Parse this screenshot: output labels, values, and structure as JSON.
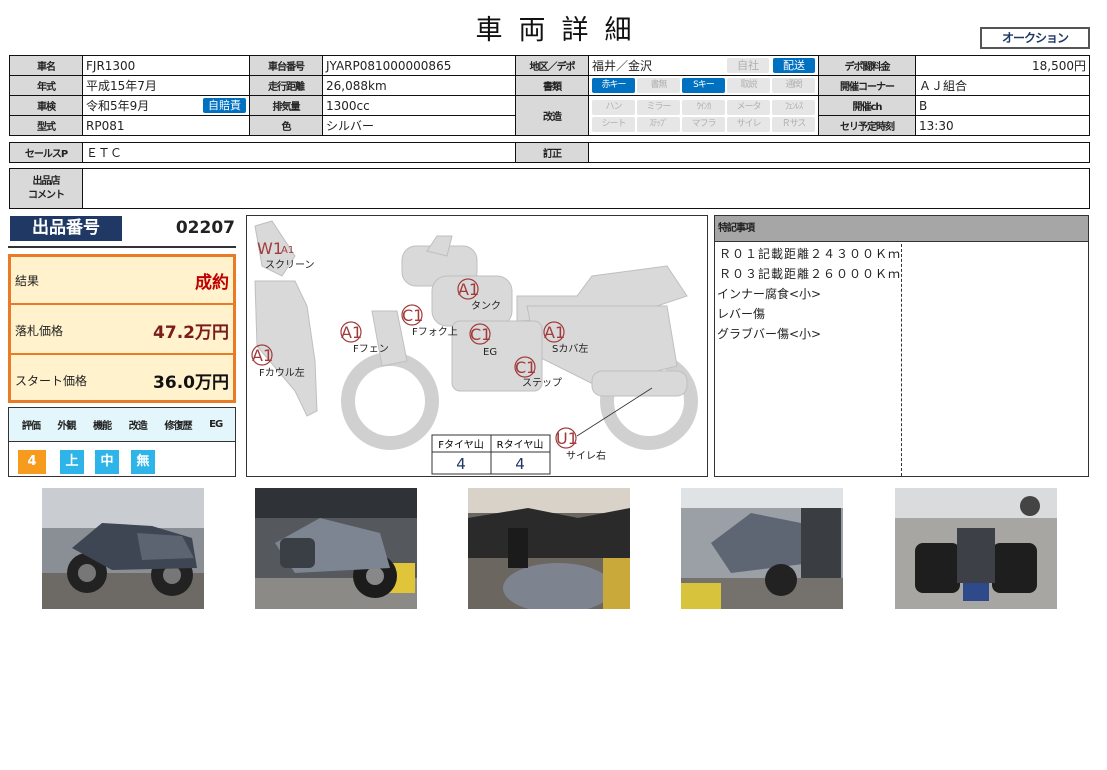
{
  "page": {
    "title": "車両詳細",
    "auction_button": "オークション"
  },
  "spec": {
    "labels": {
      "model": "車名",
      "frame": "車台番号",
      "region": "地区／デポ",
      "depo_fee": "デポ闘料金",
      "year": "年式",
      "mileage": "走行距離",
      "docs": "書類",
      "corner": "開催コーナー",
      "inspection": "車検",
      "displacement": "排気量",
      "modified": "改造",
      "channel": "開催ch",
      "type": "型式",
      "color": "色",
      "time": "セリ予定時刻",
      "sales_point": "セールスP",
      "correction": "訂正",
      "comment": "出品店\nコメント"
    },
    "model": "FJR1300",
    "frame_no": "JYARP081000000865",
    "region": "福井／金沢",
    "depo_fee": "18,500円",
    "year": "平成15年7月",
    "mileage": "26,088km",
    "corner": "ＡＪ組合",
    "inspection": "令和5年9月",
    "insurance_badge": "自賠責",
    "displacement": "1300cc",
    "channel": "B",
    "type": "RP081",
    "color": "シルバー",
    "auction_time": "13:30",
    "sales_point": "ＥＴＣ",
    "correction": "",
    "comment": "",
    "region_badges": [
      {
        "label": "自社",
        "on": false
      },
      {
        "label": "配送",
        "on": true
      }
    ],
    "doc_badges": [
      {
        "label": "赤キー",
        "on": true
      },
      {
        "label": "書無",
        "on": false
      },
      {
        "label": "Sキー",
        "on": true
      },
      {
        "label": "取説",
        "on": false
      },
      {
        "label": "通関",
        "on": false
      }
    ],
    "mod_badges": [
      {
        "label": "ハン",
        "on": false
      },
      {
        "label": "ミラー",
        "on": false
      },
      {
        "label": "ｳｲﾝｶ",
        "on": false
      },
      {
        "label": "メータ",
        "on": false
      },
      {
        "label": "ﾌｪﾝﾚｽ",
        "on": false
      },
      {
        "label": "シート",
        "on": false
      },
      {
        "label": "ｽﾃｯﾌﾟ",
        "on": false
      },
      {
        "label": "マフラ",
        "on": false
      },
      {
        "label": "サイレ",
        "on": false
      },
      {
        "label": "Ｒサス",
        "on": false
      }
    ]
  },
  "lot": {
    "label": "出品番号",
    "number": "02207"
  },
  "result": {
    "result_label": "結果",
    "result_value": "成約",
    "hammer_label": "落札価格",
    "hammer_value": "47.2万円",
    "start_label": "スタート価格",
    "start_value": "36.0万円",
    "colors": {
      "border": "#e97b26",
      "bg": "#fff2cc",
      "result": "#c00000",
      "hammer": "#7b1c1c"
    }
  },
  "evaluation": {
    "headers": [
      "評価",
      "外観",
      "機能",
      "改造",
      "修復歴",
      "EG"
    ],
    "overall": "4",
    "appearance": "上",
    "function": "中",
    "modification": "無",
    "colors": {
      "overall": "#f79b1e",
      "grade": "#2eb4e8"
    }
  },
  "diagram": {
    "marks": [
      {
        "code": "W1",
        "sub": "A1",
        "label": "スクリーン"
      },
      {
        "code": "A1",
        "label": "タンク"
      },
      {
        "code": "C1",
        "label": "Fフォク上"
      },
      {
        "code": "A1",
        "label": "Fフェン"
      },
      {
        "code": "C1",
        "label": "EG"
      },
      {
        "code": "A1",
        "label": "Sカバ左"
      },
      {
        "code": "A1",
        "label": "Fカウル左"
      },
      {
        "code": "C1",
        "label": "ステップ"
      },
      {
        "code": "U1",
        "label": "サイレ右"
      }
    ],
    "tire": {
      "front_label": "Fタイヤ山",
      "front_value": "4",
      "rear_label": "Rタイヤ山",
      "rear_value": "4"
    }
  },
  "notes": {
    "header": "特記事項",
    "lines": [
      "Ｒ０１記載距離２４３００Ｋｍ",
      "Ｒ０３記載距離２６０００Ｋｍ",
      "インナー腐食<小>",
      "レバー傷",
      "グラブバー傷<小>"
    ]
  },
  "photos": [
    "photo-1",
    "photo-2",
    "photo-3",
    "photo-4",
    "photo-5"
  ]
}
